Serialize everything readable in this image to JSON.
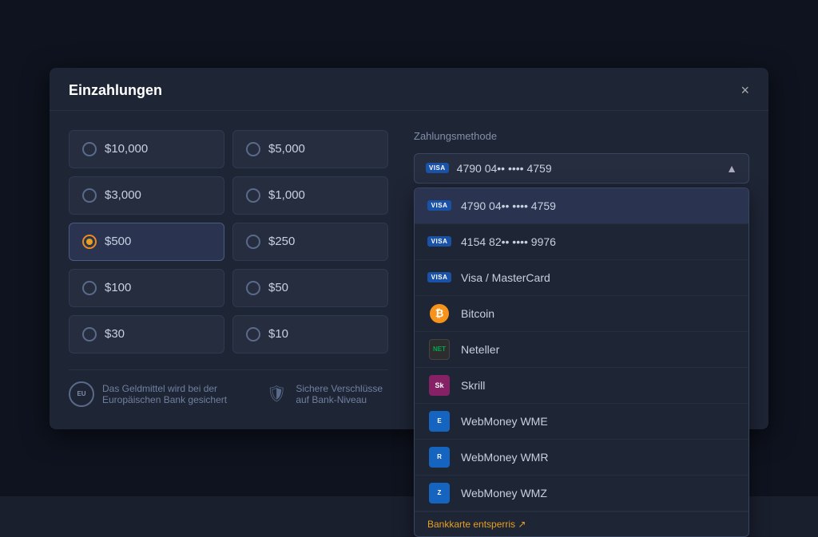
{
  "modal": {
    "title": "Einzahlungen",
    "close_label": "×"
  },
  "amounts": [
    {
      "value": "$10,000",
      "selected": false,
      "id": "amt-10000"
    },
    {
      "value": "$5,000",
      "selected": false,
      "id": "amt-5000"
    },
    {
      "value": "$3,000",
      "selected": false,
      "id": "amt-3000"
    },
    {
      "value": "$1,000",
      "selected": false,
      "id": "amt-1000"
    },
    {
      "value": "$500",
      "selected": true,
      "id": "amt-500"
    },
    {
      "value": "$250",
      "selected": false,
      "id": "amt-250"
    },
    {
      "value": "$100",
      "selected": false,
      "id": "amt-100"
    },
    {
      "value": "$50",
      "selected": false,
      "id": "amt-50"
    },
    {
      "value": "$30",
      "selected": false,
      "id": "amt-30"
    },
    {
      "value": "$10",
      "selected": false,
      "id": "amt-10"
    }
  ],
  "payment": {
    "section_label": "Zahlungsmethode",
    "selected_text": "4790 04•• •••• 4759",
    "dropdown_open": true,
    "options": [
      {
        "id": "visa1",
        "type": "visa",
        "label": "4790 04•• •••• 4759",
        "active": true
      },
      {
        "id": "visa2",
        "type": "visa",
        "label": "4154 82•• •••• 9976",
        "active": false
      },
      {
        "id": "visa3",
        "type": "visa",
        "label": "Visa / MasterCard",
        "active": false
      },
      {
        "id": "bitcoin",
        "type": "bitcoin",
        "label": "Bitcoin",
        "active": false
      },
      {
        "id": "neteller",
        "type": "neteller",
        "label": "Neteller",
        "active": false
      },
      {
        "id": "skrill",
        "type": "skrill",
        "label": "Skrill",
        "active": false
      },
      {
        "id": "webmoney-wme",
        "type": "webmoney-wme",
        "label": "WebMoney WME",
        "active": false
      },
      {
        "id": "webmoney-wmr",
        "type": "webmoney-wmr",
        "label": "WebMoney WMR",
        "active": false
      },
      {
        "id": "webmoney-wmz",
        "type": "webmoney-wmz",
        "label": "WebMoney WMZ",
        "active": false
      }
    ],
    "bottom_link": "Bankkarte entsperris"
  },
  "footer": {
    "item1_text": "Das Geldmittel wird bei der Europäischen Bank gesichert",
    "item2_text": "Sichere Verschlüsse auf Bank-Niveau"
  }
}
